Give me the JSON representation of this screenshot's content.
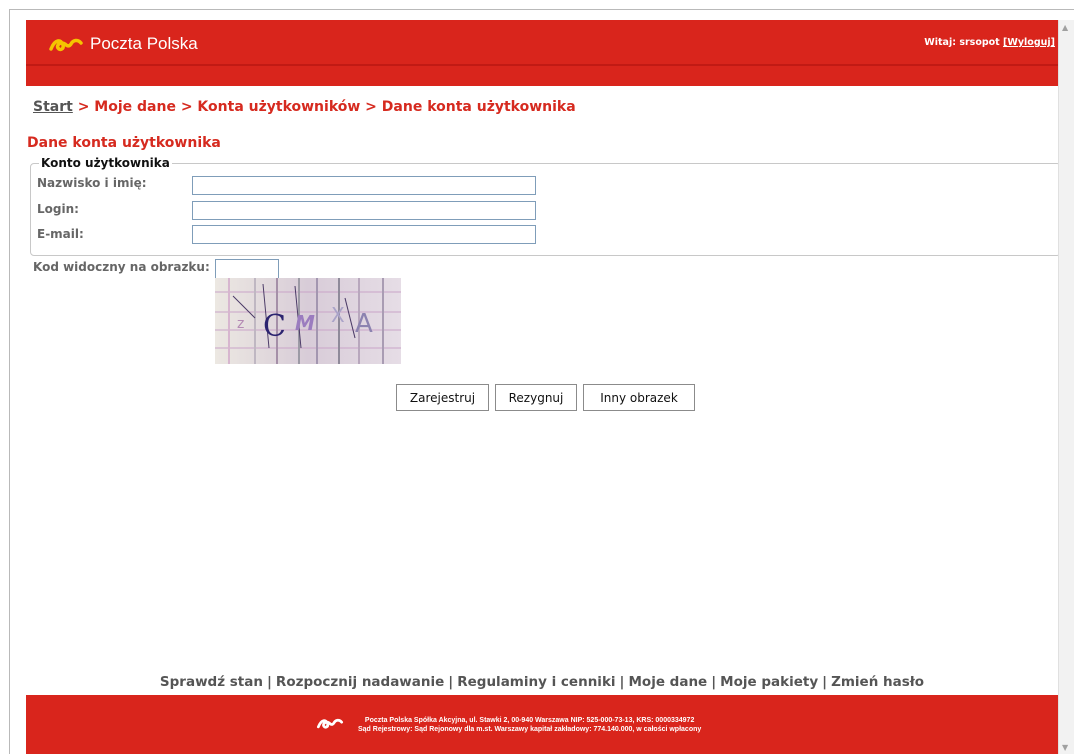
{
  "header": {
    "logo_text": "Poczta Polska",
    "welcome_prefix": "Witaj: srsopot ",
    "logout_label": "[Wyloguj]"
  },
  "breadcrumb": {
    "start": "Start",
    "rest": " > Moje dane > Konta użytkowników > Dane konta użytkownika"
  },
  "section_title": "Dane konta użytkownika",
  "fieldset": {
    "legend": "Konto użytkownika",
    "fields": [
      {
        "label": "Nazwisko i imię:",
        "value": ""
      },
      {
        "label": "Login:",
        "value": ""
      },
      {
        "label": "E-mail:",
        "value": ""
      }
    ]
  },
  "captcha": {
    "label": "Kod widoczny na obrazku:",
    "value": "",
    "image_text": "zCMXA"
  },
  "buttons": {
    "register": "Zarejestruj",
    "cancel": "Rezygnuj",
    "other_image": "Inny obrazek"
  },
  "footer_links": [
    "Sprawdź stan",
    "Rozpocznij nadawanie",
    "Regulaminy i cenniki",
    "Moje dane",
    "Moje pakiety",
    "Zmień hasło"
  ],
  "footer": {
    "line1": "Poczta Polska Spółka Akcyjna, ul. Stawki 2, 00-940 Warszawa NIP: 525-000-73-13, KRS: 0000334972",
    "line2": "Sąd Rejestrowy: Sąd Rejonowy dla m.st. Warszawy kapitał zakładowy: 774.140.000, w całości wpłacony"
  },
  "colors": {
    "brand_red": "#d9251c",
    "brand_yellow": "#f5c400",
    "heading_red": "#d62a1f"
  }
}
